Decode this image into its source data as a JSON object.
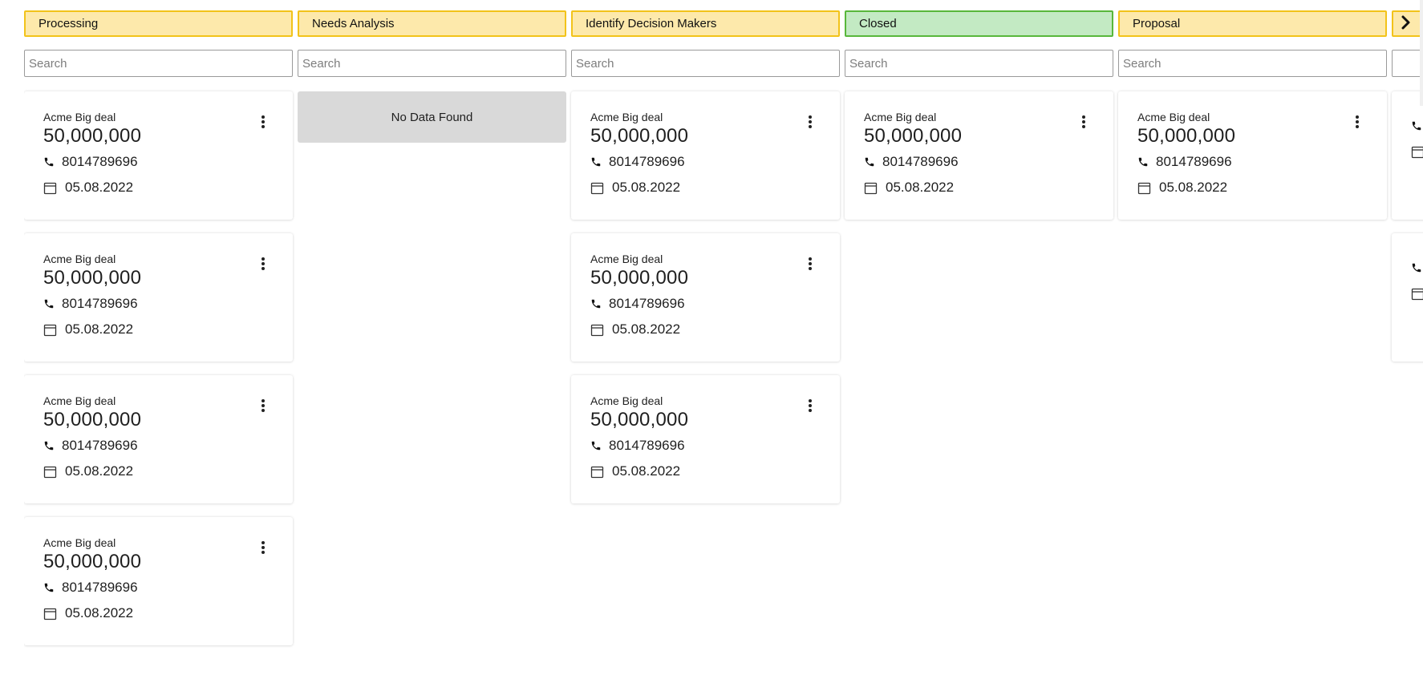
{
  "columns": [
    {
      "stage": "Processing",
      "status": "default",
      "search_placeholder": "Search",
      "empty_text": "",
      "cards": [
        {
          "title": "Acme Big deal",
          "amount": "50,000,000",
          "phone": "8014789696",
          "date": "05.08.2022"
        },
        {
          "title": "Acme Big deal",
          "amount": "50,000,000",
          "phone": "8014789696",
          "date": "05.08.2022"
        },
        {
          "title": "Acme Big deal",
          "amount": "50,000,000",
          "phone": "8014789696",
          "date": "05.08.2022"
        },
        {
          "title": "Acme Big deal",
          "amount": "50,000,000",
          "phone": "8014789696",
          "date": "05.08.2022"
        }
      ]
    },
    {
      "stage": "Needs Analysis",
      "status": "default",
      "search_placeholder": "Search",
      "empty_text": "No Data Found",
      "cards": []
    },
    {
      "stage": "Identify Decision Makers",
      "status": "default",
      "search_placeholder": "Search",
      "empty_text": "",
      "cards": [
        {
          "title": "Acme Big deal",
          "amount": "50,000,000",
          "phone": "8014789696",
          "date": "05.08.2022"
        },
        {
          "title": "Acme Big deal",
          "amount": "50,000,000",
          "phone": "8014789696",
          "date": "05.08.2022"
        },
        {
          "title": "Acme Big deal",
          "amount": "50,000,000",
          "phone": "8014789696",
          "date": "05.08.2022"
        }
      ]
    },
    {
      "stage": "Closed",
      "status": "closed",
      "search_placeholder": "Search",
      "empty_text": "",
      "cards": [
        {
          "title": "Acme Big deal",
          "amount": "50,000,000",
          "phone": "8014789696",
          "date": "05.08.2022"
        }
      ]
    },
    {
      "stage": "Proposal",
      "status": "default",
      "search_placeholder": "Search",
      "empty_text": "",
      "cards": [
        {
          "title": "Acme Big deal",
          "amount": "50,000,000",
          "phone": "8014789696",
          "date": "05.08.2022"
        }
      ]
    },
    {
      "stage": "",
      "status": "default",
      "search_placeholder": "",
      "empty_text": "",
      "cards": [
        {
          "title": "",
          "amount": "",
          "phone": "",
          "date": ""
        },
        {
          "title": "",
          "amount": "",
          "phone": "",
          "date": ""
        }
      ]
    }
  ],
  "colors": {
    "stage_border": "#f2c31a",
    "stage_fill": "#fde9ab",
    "closed_border": "#58b73b",
    "closed_fill": "#c3eac3",
    "empty_fill": "#d9d9d9"
  },
  "icons": {
    "phone": "phone-icon",
    "date": "calendar-icon",
    "menu": "more-vertical-icon",
    "next": "chevron-right-icon"
  }
}
